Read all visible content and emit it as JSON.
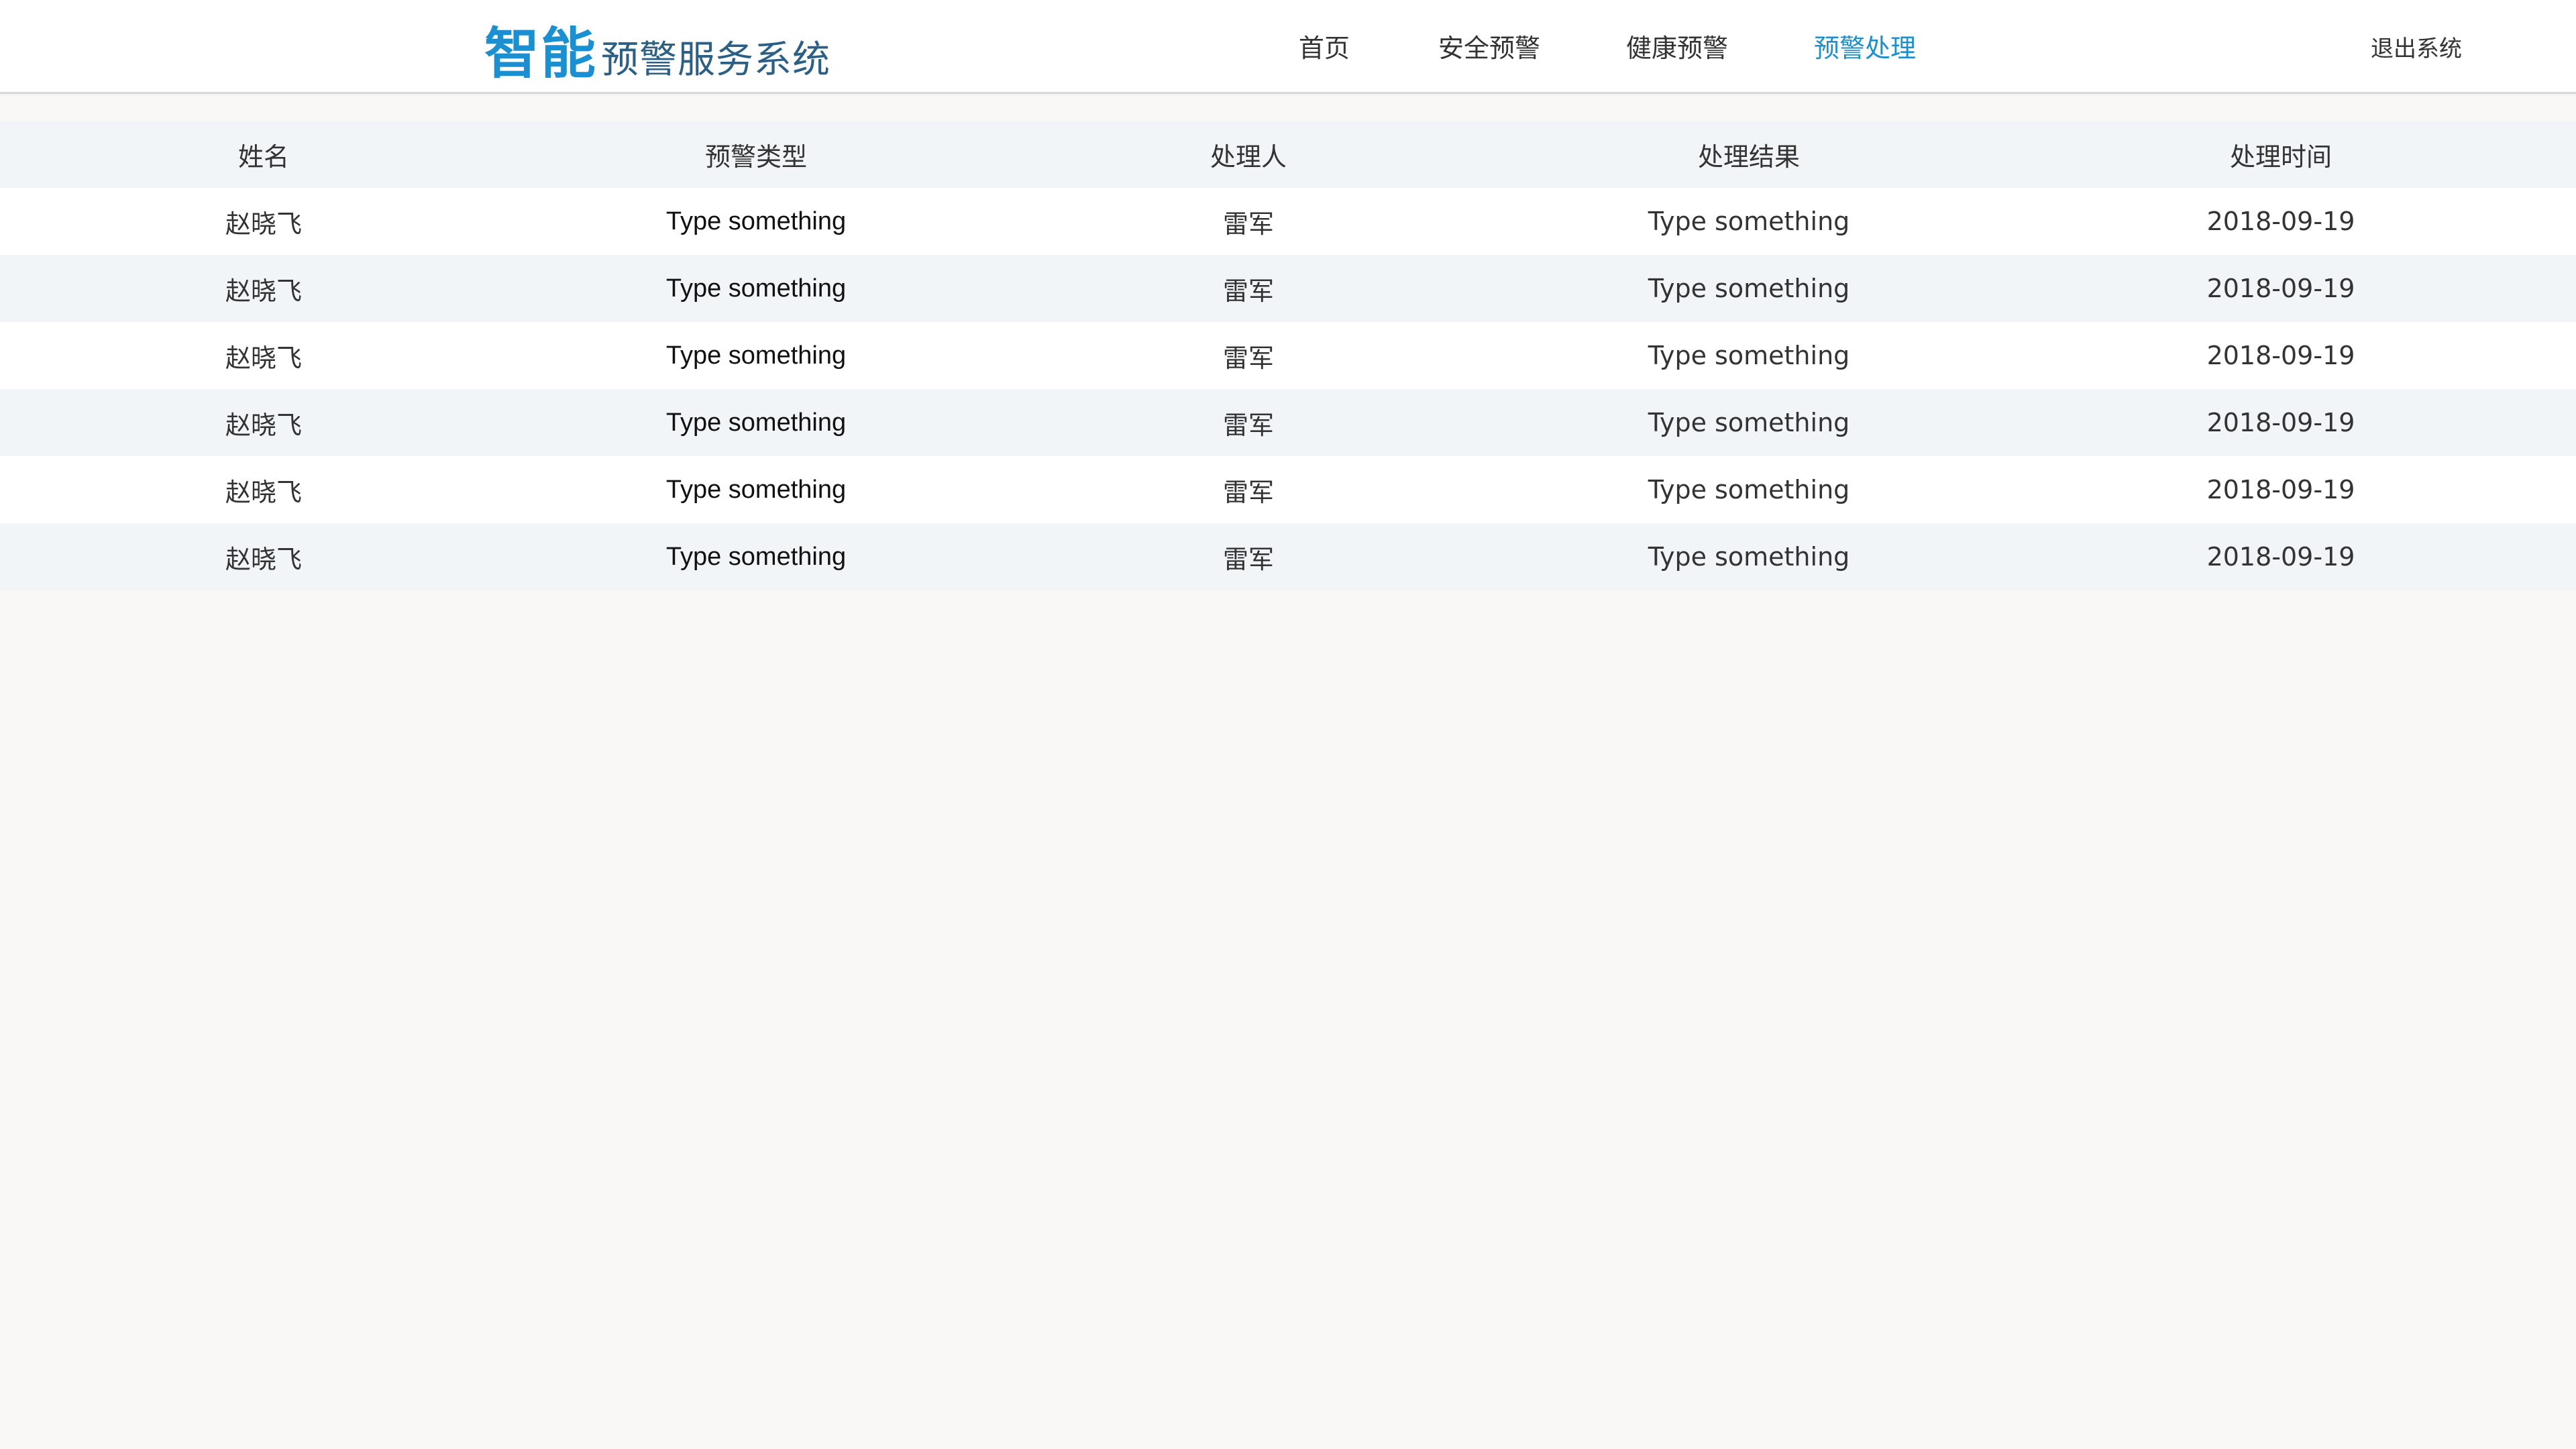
{
  "colors": {
    "brand_primary": "#1a8fd1",
    "brand_secondary": "#2b5f86",
    "row_stripe": "#f1f5f7"
  },
  "header": {
    "logo_strong": "智能",
    "logo_rest": "预警服务系统",
    "nav": [
      {
        "label": "首页",
        "active": false
      },
      {
        "label": "安全预警",
        "active": false
      },
      {
        "label": "健康预警",
        "active": false
      },
      {
        "label": "预警处理",
        "active": true
      }
    ],
    "logout_label": "退出系统"
  },
  "table": {
    "columns": [
      "姓名",
      "预警类型",
      "处理人",
      "处理结果",
      "处理时间"
    ],
    "rows": [
      [
        "赵晓飞",
        "Type something",
        "雷军",
        "Type something",
        "2018-09-19"
      ],
      [
        "赵晓飞",
        "Type something",
        "雷军",
        "Type something",
        "2018-09-19"
      ],
      [
        "赵晓飞",
        "Type something",
        "雷军",
        "Type something",
        "2018-09-19"
      ],
      [
        "赵晓飞",
        "Type something",
        "雷军",
        "Type something",
        "2018-09-19"
      ],
      [
        "赵晓飞",
        "Type something",
        "雷军",
        "Type something",
        "2018-09-19"
      ],
      [
        "赵晓飞",
        "Type something",
        "雷军",
        "Type something",
        "2018-09-19"
      ]
    ]
  }
}
